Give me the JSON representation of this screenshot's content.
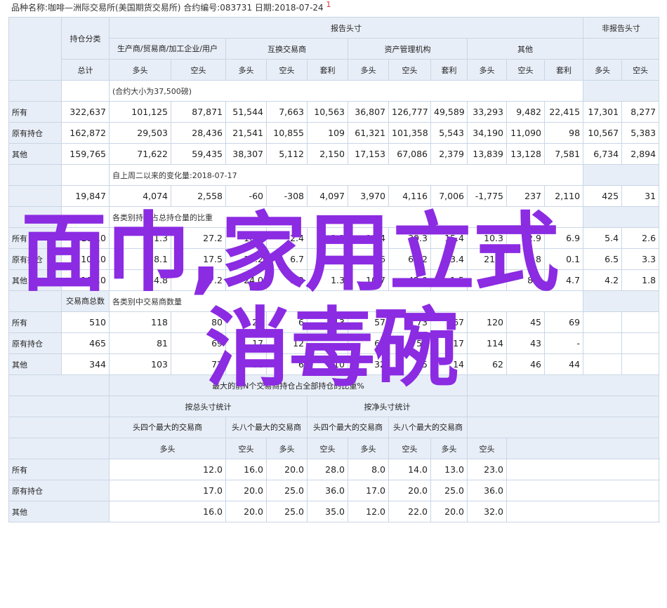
{
  "header": {
    "text": "品种名称:咖啡—洲际交易所(美国期货交易所)  合约编号:083731  日期:2018-07-24",
    "note": "1"
  },
  "overlay": {
    "line1": "面巾,家用立式",
    "line2": "消毒碗"
  },
  "groups": {
    "reportable": "报告头寸",
    "nonreportable": "非报告头寸",
    "position_class": "持仓分类",
    "producer": "生产商/贸易商/加工企业/用户",
    "swap": "互换交易商",
    "managed": "资产管理机构",
    "other": "其他"
  },
  "sub": {
    "total": "总计",
    "long": "多头",
    "short": "空头",
    "spread": "套利"
  },
  "section1": {
    "title": "(合约大小为37,500磅)",
    "rows": [
      {
        "label": "所有",
        "v": [
          "322,637",
          "101,125",
          "87,871",
          "51,544",
          "7,663",
          "10,563",
          "36,807",
          "126,777",
          "49,589",
          "33,293",
          "9,482",
          "22,415",
          "17,301",
          "8,277"
        ]
      },
      {
        "label": "原有持仓",
        "v": [
          "162,872",
          "29,503",
          "28,436",
          "21,541",
          "10,855",
          "109",
          "61,321",
          "101,358",
          "5,543",
          "34,190",
          "11,090",
          "98",
          "10,567",
          "5,383"
        ]
      },
      {
        "label": "其他",
        "v": [
          "159,765",
          "71,622",
          "59,435",
          "38,307",
          "5,112",
          "2,150",
          "17,153",
          "67,086",
          "2,379",
          "13,839",
          "13,128",
          "7,581",
          "6,734",
          "2,894"
        ]
      }
    ]
  },
  "section2": {
    "title": "自上周二以来的变化量:2018-07-17",
    "values": [
      "19,847",
      "4,074",
      "2,558",
      "-60",
      "-308",
      "4,097",
      "3,970",
      "4,116",
      "7,006",
      "-1,775",
      "237",
      "2,110",
      "425",
      "31"
    ]
  },
  "section3": {
    "title": "各类别持仓占总持仓量的比重",
    "rows": [
      {
        "label": "所有",
        "v": [
          "100.0",
          "31.3",
          "27.2",
          "16.0",
          "2.4",
          "3.3",
          "11.4",
          "39.3",
          "15.4",
          "10.3",
          "2.9",
          "6.9",
          "5.4",
          "2.6"
        ]
      },
      {
        "label": "原有持仓",
        "v": [
          "100.0",
          "18.1",
          "17.5",
          "13.2",
          "6.7",
          "0.1",
          "37.6",
          "62.2",
          "3.4",
          "21.0",
          "6.8",
          "0.1",
          "6.5",
          "3.3"
        ]
      },
      {
        "label": "其他",
        "v": [
          "100.0",
          "44.8",
          "37.2",
          "24.0",
          "3.2",
          "1.3",
          "10.7",
          "42.0",
          "1.5",
          "8.7",
          "8.2",
          "4.7",
          "4.2",
          "1.8"
        ]
      }
    ]
  },
  "section4": {
    "head": "交易商总数",
    "title": "各类别中交易商数量",
    "rows": [
      {
        "label": "所有",
        "v": [
          "510",
          "118",
          "80",
          "24",
          "6",
          "13",
          "57",
          "73",
          "67",
          "120",
          "45",
          "69",
          "",
          ""
        ]
      },
      {
        "label": "原有持仓",
        "v": [
          "465",
          "81",
          "69",
          "17",
          "12",
          "",
          "69",
          "53",
          "17",
          "114",
          "43",
          "-",
          "",
          ""
        ]
      },
      {
        "label": "其他",
        "v": [
          "344",
          "103",
          "72",
          "22",
          "6",
          "10",
          "32",
          "55",
          "14",
          "62",
          "46",
          "44",
          "",
          ""
        ]
      }
    ]
  },
  "section5": {
    "title": "最大的前N个交易商持仓占全部持仓的比重%",
    "gross": "按总头寸统计",
    "net": "按净头寸统计",
    "top4": "头四个最大的交易商",
    "top8": "头八个最大的交易商",
    "rows": [
      {
        "label": "所有",
        "v": [
          "12.0",
          "16.0",
          "20.0",
          "28.0",
          "8.0",
          "14.0",
          "13.0",
          "23.0"
        ]
      },
      {
        "label": "原有持仓",
        "v": [
          "17.0",
          "20.0",
          "25.0",
          "36.0",
          "17.0",
          "20.0",
          "25.0",
          "36.0"
        ]
      },
      {
        "label": "其他",
        "v": [
          "16.0",
          "20.0",
          "25.0",
          "35.0",
          "12.0",
          "22.0",
          "20.0",
          "32.0"
        ]
      }
    ]
  }
}
